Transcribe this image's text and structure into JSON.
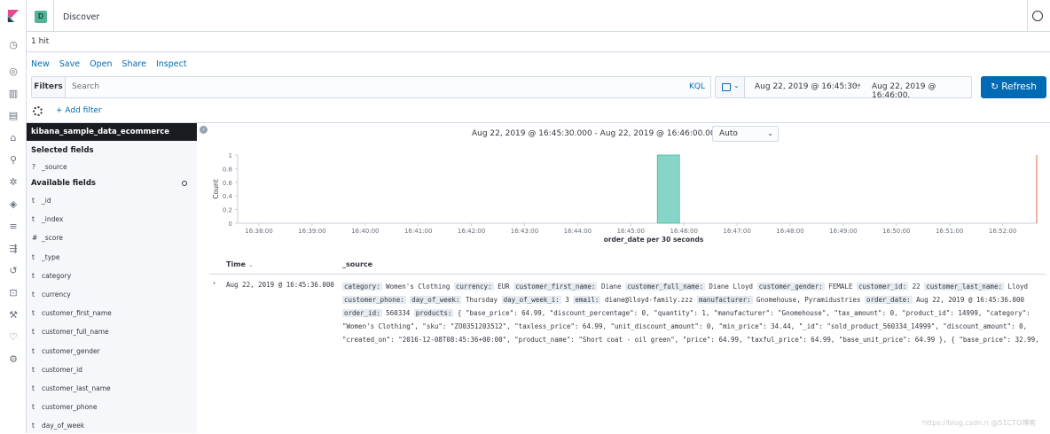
{
  "header": {
    "space_letter": "D",
    "breadcrumb": "Discover"
  },
  "hits": "1 hit",
  "top_menu": [
    "New",
    "Save",
    "Open",
    "Share",
    "Inspect"
  ],
  "query_bar": {
    "filters_label": "Filters",
    "search_placeholder": "Search",
    "language": "KQL",
    "date_start": "Aug 22, 2019 @ 16:45:30.",
    "date_end": "Aug 22, 2019 @ 16:46:00.",
    "arrow": "→",
    "refresh_label": "Refresh"
  },
  "filter_row": {
    "add_filter": "+ Add filter"
  },
  "sidebar": {
    "index_pattern": "kibana_sample_data_ecommerce",
    "selected_title": "Selected fields",
    "selected_fields": [
      {
        "type": "?",
        "name": "_source"
      }
    ],
    "available_title": "Available fields",
    "available_fields": [
      {
        "type": "t",
        "name": "_id"
      },
      {
        "type": "t",
        "name": "_index"
      },
      {
        "type": "#",
        "name": "_score"
      },
      {
        "type": "t",
        "name": "_type"
      },
      {
        "type": "t",
        "name": "category"
      },
      {
        "type": "t",
        "name": "currency"
      },
      {
        "type": "t",
        "name": "customer_first_name"
      },
      {
        "type": "t",
        "name": "customer_full_name"
      },
      {
        "type": "t",
        "name": "customer_gender"
      },
      {
        "type": "t",
        "name": "customer_id"
      },
      {
        "type": "t",
        "name": "customer_last_name"
      },
      {
        "type": "t",
        "name": "customer_phone"
      },
      {
        "type": "t",
        "name": "day_of_week"
      }
    ]
  },
  "chart_header": {
    "range": "Aug 22, 2019 @ 16:45:30.000 - Aug 22, 2019 @ 16:46:00.000 —",
    "interval": "Auto"
  },
  "chart_data": {
    "type": "bar",
    "categories": [
      "16:38:00",
      "16:39:00",
      "16:40:00",
      "16:41:00",
      "16:42:00",
      "16:43:00",
      "16:44:00",
      "16:45:00",
      "16:46:00",
      "16:47:00",
      "16:48:00",
      "16:49:00",
      "16:50:00",
      "16:51:00",
      "16:52:00"
    ],
    "bar": {
      "x": "16:45:30",
      "value": 1
    },
    "ylabel": "Count",
    "xlabel": "order_date per 30 seconds",
    "yticks": [
      "0",
      "0.2",
      "0.4",
      "0.6",
      "0.8",
      "1"
    ],
    "ylim": [
      0,
      1
    ],
    "colors": {
      "bar": "#86d5c8",
      "bar_stroke": "#54b399",
      "now_line": "#e7664c"
    }
  },
  "table": {
    "col_time": "Time",
    "col_source": "_source",
    "row_time": "Aug 22, 2019 @ 16:45:36.000",
    "source_fields": [
      {
        "k": "category:",
        "v": "Women's Clothing"
      },
      {
        "k": "currency:",
        "v": "EUR"
      },
      {
        "k": "customer_first_name:",
        "v": "Diane"
      },
      {
        "k": "customer_full_name:",
        "v": "Diane Lloyd"
      },
      {
        "k": "customer_gender:",
        "v": "FEMALE"
      },
      {
        "k": "customer_id:",
        "v": "22"
      },
      {
        "k": "customer_last_name:",
        "v": "Lloyd"
      },
      {
        "k": "customer_phone:",
        "v": ""
      },
      {
        "k": "day_of_week:",
        "v": "Thursday"
      },
      {
        "k": "day_of_week_i:",
        "v": "3"
      },
      {
        "k": "email:",
        "v": "diane@lloyd-family.zzz"
      },
      {
        "k": "manufacturer:",
        "v": "Gnomehouse, Pyramidustries"
      },
      {
        "k": "order_date:",
        "v": "Aug 22, 2019 @ 16:45:36.000"
      },
      {
        "k": "order_id:",
        "v": "560334"
      },
      {
        "k": "products:",
        "v": "{ \"base_price\": 64.99, \"discount_percentage\": 0, \"quantity\": 1, \"manufacturer\": \"Gnomehouse\", \"tax_amount\": 0, \"product_id\": 14999, \"category\": \"Women's Clothing\", \"sku\": \"ZO0351203512\", \"taxless_price\": 64.99, \"unit_discount_amount\": 0, \"min_price\": 34.44, \"_id\": \"sold_product_560334_14999\", \"discount_amount\": 0, \"created_on\": \"2016-12-08T08:45:36+00:00\", \"product_name\": \"Short coat - oil green\", \"price\": 64.99, \"taxful_price\": 64.99, \"base_unit_price\": 64.99 }, { \"base_price\": 32.99,"
      }
    ]
  },
  "watermark": "https://blog.csdn.n @51CTO博客"
}
